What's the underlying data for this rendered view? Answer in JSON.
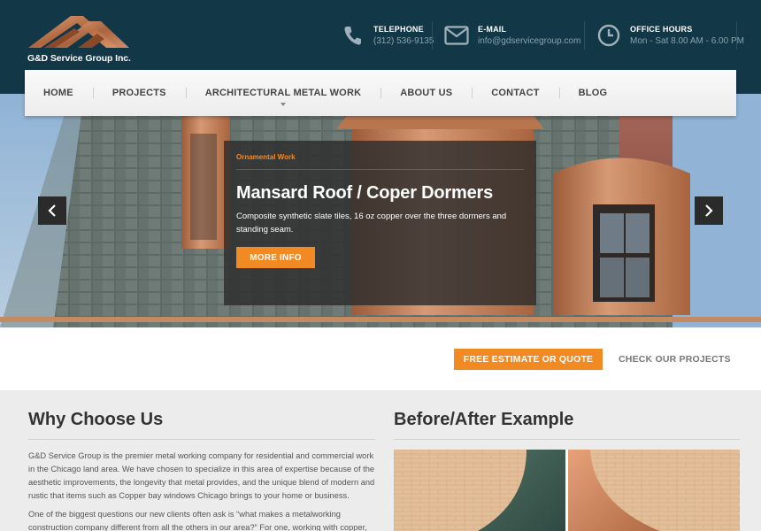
{
  "brand": {
    "name": "G&D Service Group Inc."
  },
  "contacts": [
    {
      "title": "TELEPHONE",
      "value": "(312) 536-9135",
      "icon": "phone-icon"
    },
    {
      "title": "E-MAIL",
      "value": "info@gdservicegroup.com",
      "icon": "mail-icon"
    },
    {
      "title": "OFFICE HOURS",
      "value": "Mon - Sat 8.00 AM - 6.00 PM",
      "icon": "clock-icon"
    }
  ],
  "nav": {
    "items": [
      "HOME",
      "PROJECTS",
      "ARCHITECTURAL METAL WORK",
      "ABOUT US",
      "CONTACT",
      "BLOG"
    ]
  },
  "slide": {
    "category": "Ornamental Work",
    "title": "Mansard Roof / Coper Dormers",
    "text": "Composite synthetic slate tiles, 16 oz copper over the three dormers and standing seam.",
    "button": "MORE INFO"
  },
  "cta": {
    "estimate": "FREE ESTIMATE OR QUOTE",
    "projects": "CHECK OUR PROJECTS"
  },
  "why": {
    "heading": "Why Choose Us",
    "p1": "G&D Service Group is the premier metal working company for residential and commercial work in the Chicago land area. We have chosen to specialize in this area of expertise because of the aesthetic improvements, the longevity that metal provides, and the unique blend of modern and rustic that items such as Copper bay windows Chicago brings to your home or business.",
    "p2": "One of the biggest questions our new clients often ask is “what makes a metalworking construction company different from all the others in our area?” For one, working with copper,"
  },
  "before_after": {
    "heading": "Before/After Example"
  },
  "colors": {
    "header": "#123747",
    "accent": "#f28a24",
    "nav_text": "#444444"
  }
}
